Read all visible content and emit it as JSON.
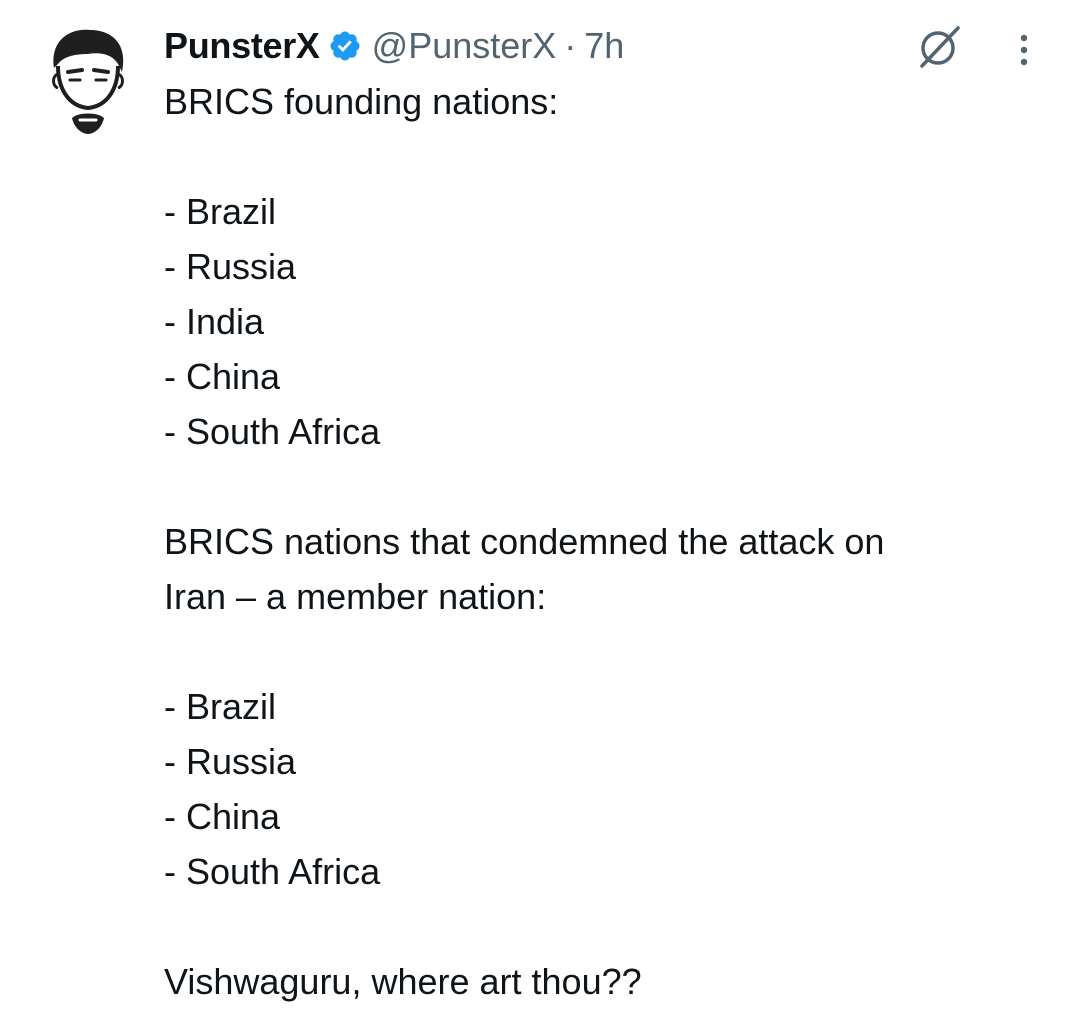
{
  "author": {
    "display_name": "PunsterX",
    "handle": "@PunsterX",
    "separator": "·",
    "time": "7h",
    "verified": true
  },
  "icons": {
    "avatar": "avatar-illustration",
    "verified": "verified-badge-icon",
    "grok": "grok-icon",
    "more": "more-vertical-icon"
  },
  "colors": {
    "verified_blue": "#1d9bf0",
    "text_primary": "#0f1419",
    "text_secondary": "#536471"
  },
  "tweet": {
    "heading1": "BRICS founding nations:",
    "list1": [
      "- Brazil",
      "- Russia",
      "- India",
      "- China",
      "- South Africa"
    ],
    "heading2_line1": "BRICS nations that condemned the attack on",
    "heading2_line2": "Iran – a member nation:",
    "list2": [
      "- Brazil",
      "- Russia",
      "- China",
      "- South Africa"
    ],
    "closing": "Vishwaguru, where art thou??"
  }
}
